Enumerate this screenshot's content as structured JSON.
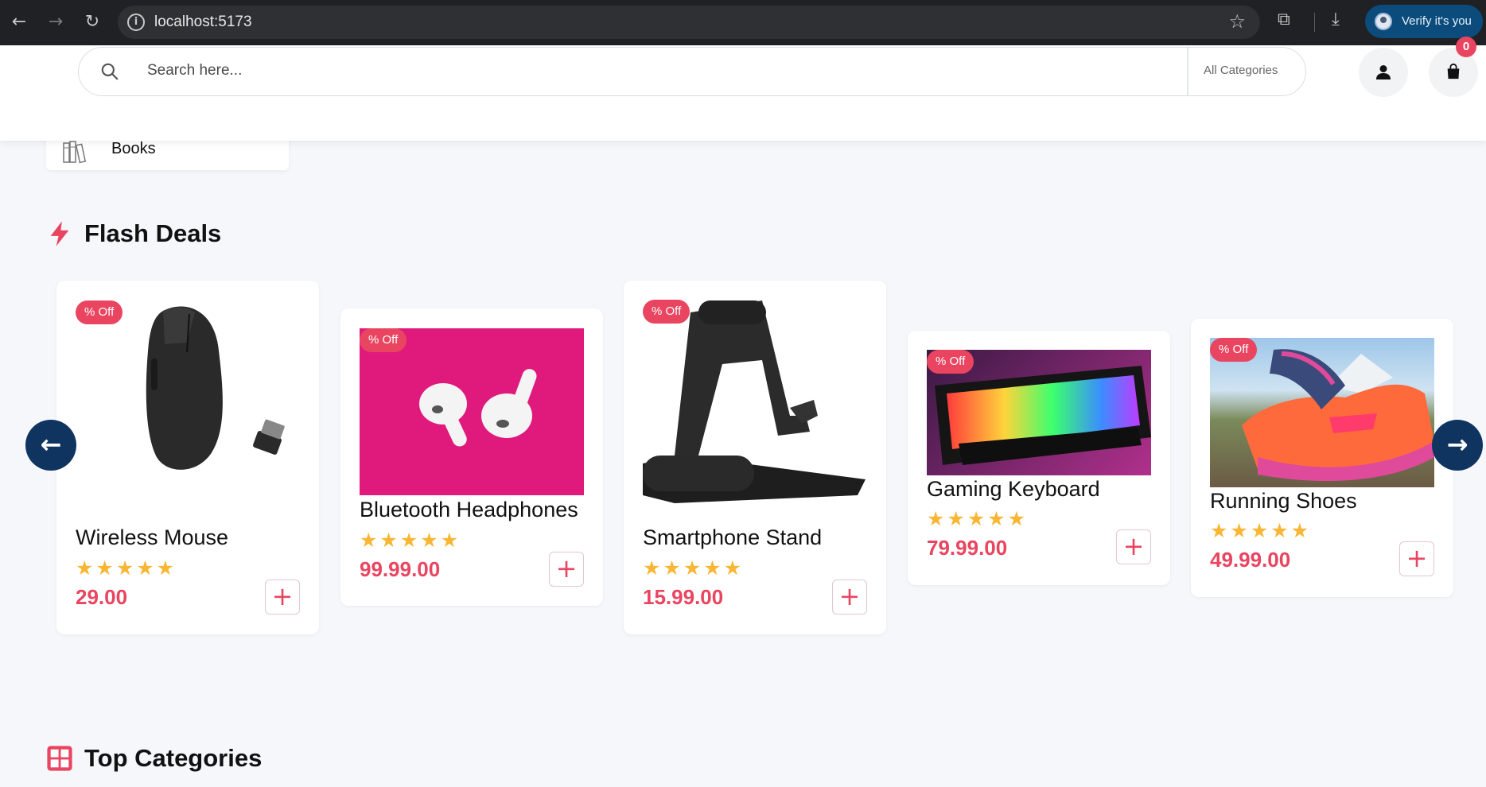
{
  "browser": {
    "url": "localhost:5173",
    "back_icon": "arrow-left-icon",
    "forward_icon": "arrow-right-icon",
    "reload_icon": "reload-icon",
    "verify_label": "Verify it's you"
  },
  "header": {
    "search_placeholder": "Search here...",
    "category_select": "All Categories",
    "cart_count": "0"
  },
  "category_dropdown": {
    "item_label": "Books"
  },
  "flash_deals": {
    "title": "Flash Deals",
    "products": [
      {
        "badge": "% Off",
        "name": "Wireless Mouse",
        "rating": 5,
        "price": "29.00"
      },
      {
        "badge": "% Off",
        "name": "Bluetooth Headphones",
        "rating": 5,
        "price": "99.99.00"
      },
      {
        "badge": "% Off",
        "name": "Smartphone Stand",
        "rating": 5,
        "price": "15.99.00"
      },
      {
        "badge": "% Off",
        "name": "Gaming Keyboard",
        "rating": 5,
        "price": "79.99.00"
      },
      {
        "badge": "% Off",
        "name": "Running Shoes",
        "rating": 5,
        "price": "49.99.00"
      }
    ]
  },
  "top_categories": {
    "title": "Top Categories"
  },
  "colors": {
    "accent": "#e94560",
    "navy": "#0f3460",
    "star": "#f9b634"
  }
}
